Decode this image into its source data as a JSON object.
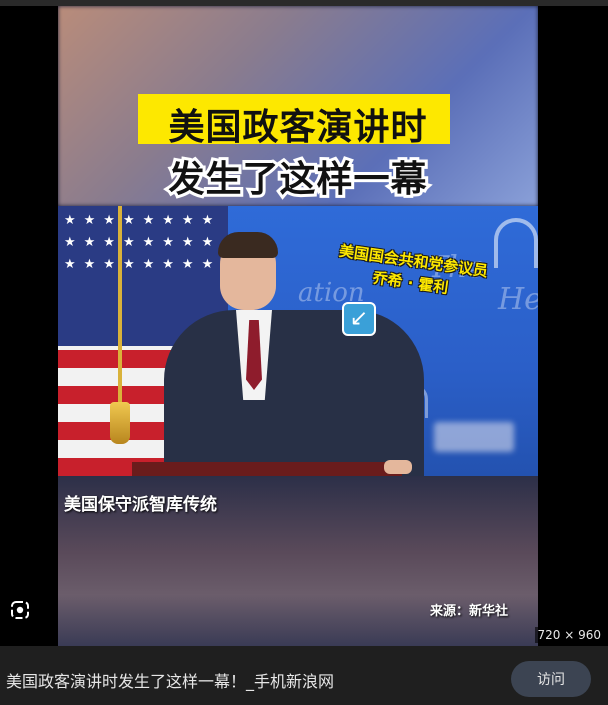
{
  "image": {
    "headline_line1": "美国政客演讲时",
    "headline_line2": "发生了这样一幕",
    "name_tag_line1": "美国国会共和党参议员",
    "name_tag_line2": "乔希 · 霍利",
    "caption": "美国保守派智库传统",
    "source": "来源：新华社",
    "accent_yellow": "#fde800"
  },
  "viewer": {
    "dimensions": "720 × 960",
    "lens_icon": "lens-icon"
  },
  "footer": {
    "title": "美国政客演讲时发生了这样一幕！_手机新浪网",
    "visit_label": "访问"
  }
}
